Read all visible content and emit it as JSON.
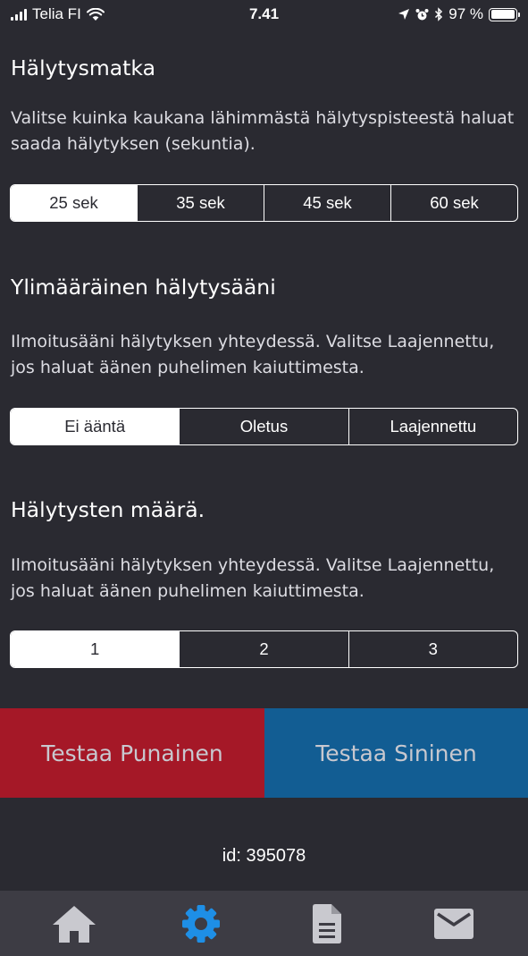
{
  "status_bar": {
    "carrier": "Telia FI",
    "time": "7.41",
    "battery": "97 %",
    "battery_level": 0.97
  },
  "sections": [
    {
      "title": "Hälytysmatka",
      "description": "Valitse kuinka kaukana lähimmästä hälytyspisteestä haluat saada hälytyksen (sekuntia).",
      "options": [
        "25 sek",
        "35 sek",
        "45 sek",
        "60 sek"
      ],
      "selected": 0
    },
    {
      "title": "Ylimääräinen hälytysääni",
      "description": "Ilmoitusääni hälytyksen yhteydessä. Valitse Laajennettu, jos haluat äänen puhelimen kaiuttimesta.",
      "options": [
        "Ei ääntä",
        "Oletus",
        "Laajennettu"
      ],
      "selected": 0
    },
    {
      "title": "Hälytysten määrä.",
      "description": "Ilmoitusääni hälytyksen yhteydessä. Valitse Laajennettu, jos haluat äänen puhelimen kaiuttimesta.",
      "options": [
        "1",
        "2",
        "3"
      ],
      "selected": 0
    }
  ],
  "test_buttons": {
    "red_label": "Testaa Punainen",
    "blue_label": "Testaa Sininen"
  },
  "device_id": "id: 395078",
  "tab_bar": {
    "items": [
      {
        "icon": "home-icon",
        "active": false
      },
      {
        "icon": "gear-icon",
        "active": true
      },
      {
        "icon": "document-icon",
        "active": false
      },
      {
        "icon": "mail-icon",
        "active": false
      }
    ]
  },
  "colors": {
    "background": "#2a2a31",
    "red": "#a51827",
    "blue": "#125d93",
    "tab_active": "#1e8fe6",
    "tab_inactive": "#c9c9cf",
    "tab_bar": "#3d3c44"
  }
}
